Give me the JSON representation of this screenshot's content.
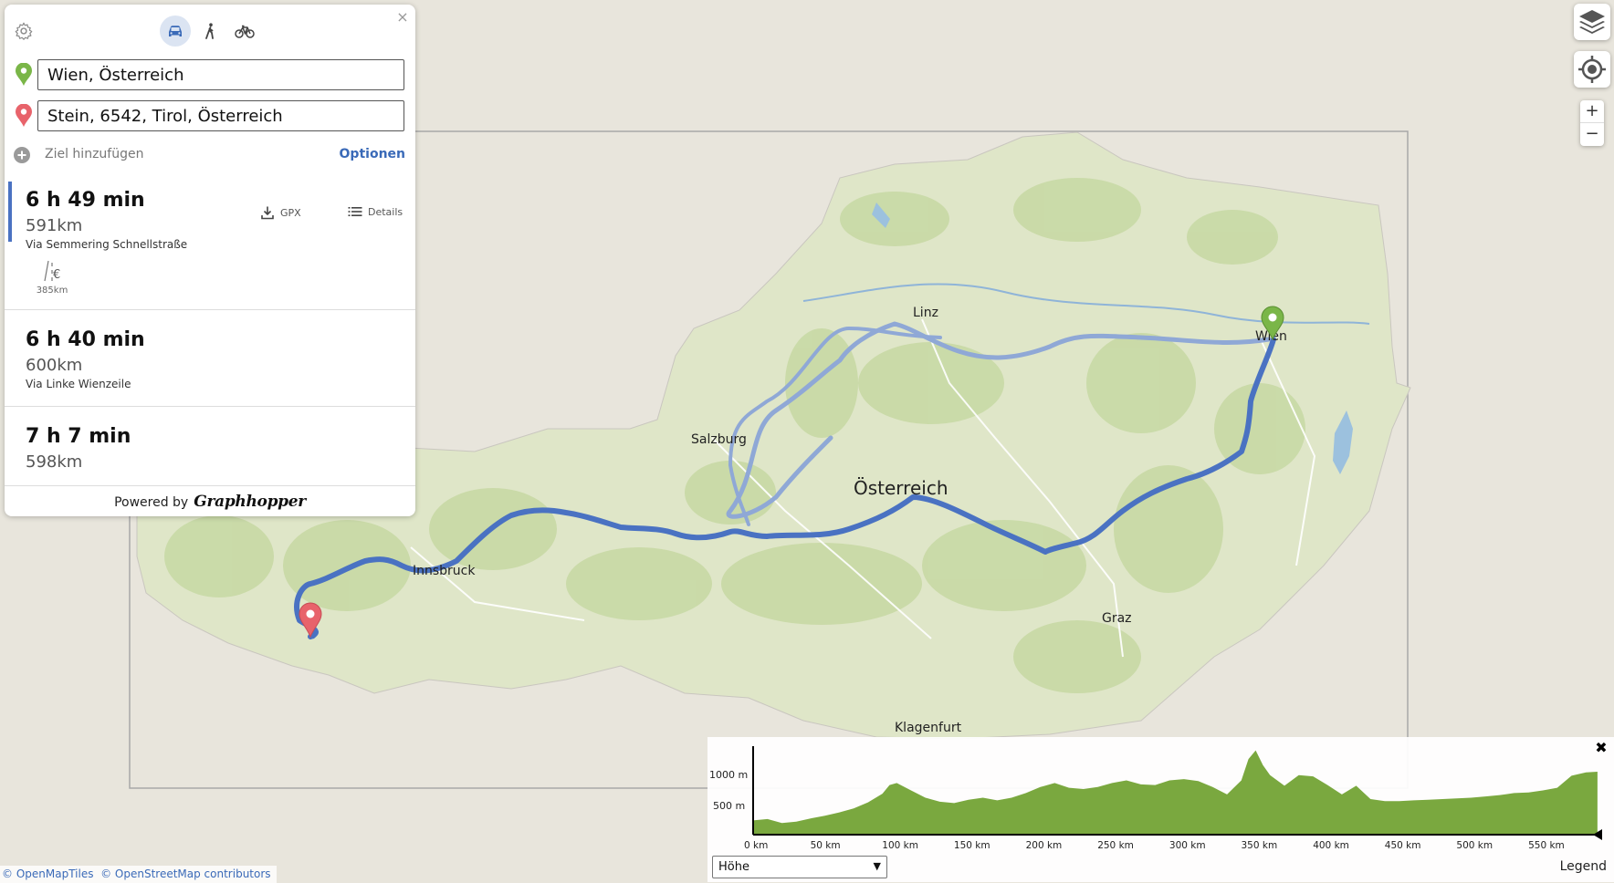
{
  "map": {
    "places": [
      {
        "label": "Linz"
      },
      {
        "label": "Wien"
      },
      {
        "label": "Salzburg"
      },
      {
        "label": "Österreich"
      },
      {
        "label": "Innsbruck"
      },
      {
        "label": "Graz"
      },
      {
        "label": "Klagenfurt"
      }
    ],
    "route_color": "#4a72c2",
    "alt_route_color": "#8fa8d6",
    "start_pin_color": "#7ab648",
    "end_pin_color": "#e8636b"
  },
  "panel": {
    "settings_icon": "gear-icon",
    "close_label": "×",
    "vehicles": [
      {
        "name": "car",
        "icon": "car-icon",
        "active": true
      },
      {
        "name": "foot",
        "icon": "walk-icon",
        "active": false
      },
      {
        "name": "bike",
        "icon": "bike-icon",
        "active": false
      }
    ],
    "from_value": "Wien, Österreich",
    "to_value": "Stein, 6542, Tirol, Österreich",
    "add_destination": "Ziel hinzufügen",
    "options": "Optionen",
    "routes": [
      {
        "time": "6 h 49 min",
        "distance": "591km",
        "via": "Via Semmering Schnellstraße",
        "gpx": "GPX",
        "details": "Details",
        "toll_distance": "385km"
      },
      {
        "time": "6 h 40 min",
        "distance": "600km",
        "via": "Via Linke Wienzeile"
      },
      {
        "time": "7 h 7 min",
        "distance": "598km",
        "via": ""
      }
    ],
    "powered_by": "Powered by",
    "brand": "Graphhopper"
  },
  "map_controls": {
    "layers_icon": "layers-icon",
    "locate_icon": "locate-icon",
    "zoom_in": "+",
    "zoom_out": "−"
  },
  "elevation": {
    "close_label": "✖",
    "select_value": "Höhe",
    "legend": "Legend",
    "y_ticks": [
      "1000 m",
      "500 m"
    ],
    "x_ticks": [
      "0 km",
      "50 km",
      "100 km",
      "150 km",
      "200 km",
      "250 km",
      "300 km",
      "350 km",
      "400 km",
      "450 km",
      "500 km",
      "550 km"
    ]
  },
  "chart_data": {
    "type": "area",
    "x": [
      0,
      10,
      20,
      30,
      40,
      50,
      60,
      70,
      80,
      90,
      95,
      100,
      110,
      120,
      130,
      140,
      150,
      160,
      170,
      180,
      190,
      200,
      210,
      220,
      230,
      240,
      250,
      260,
      270,
      280,
      290,
      300,
      310,
      320,
      330,
      340,
      345,
      350,
      355,
      360,
      370,
      380,
      390,
      400,
      410,
      420,
      430,
      440,
      450,
      460,
      470,
      480,
      490,
      500,
      510,
      520,
      530,
      540,
      550,
      560,
      570,
      580,
      588
    ],
    "y": [
      200,
      220,
      160,
      180,
      230,
      270,
      320,
      380,
      470,
      600,
      730,
      760,
      650,
      540,
      480,
      460,
      510,
      540,
      500,
      540,
      610,
      700,
      760,
      690,
      670,
      700,
      760,
      800,
      740,
      730,
      800,
      820,
      790,
      700,
      590,
      800,
      1120,
      1250,
      1030,
      880,
      720,
      880,
      860,
      730,
      590,
      720,
      520,
      490,
      490,
      500,
      510,
      520,
      530,
      540,
      560,
      580,
      610,
      620,
      650,
      690,
      870,
      920,
      930
    ],
    "xlim": [
      0,
      590
    ],
    "ylim": [
      0,
      1450
    ],
    "xlabel": "",
    "ylabel": "",
    "fill_color": "#7aa83f"
  },
  "attribution": {
    "omt": "© OpenMapTiles",
    "osm": "© OpenStreetMap contributors"
  }
}
